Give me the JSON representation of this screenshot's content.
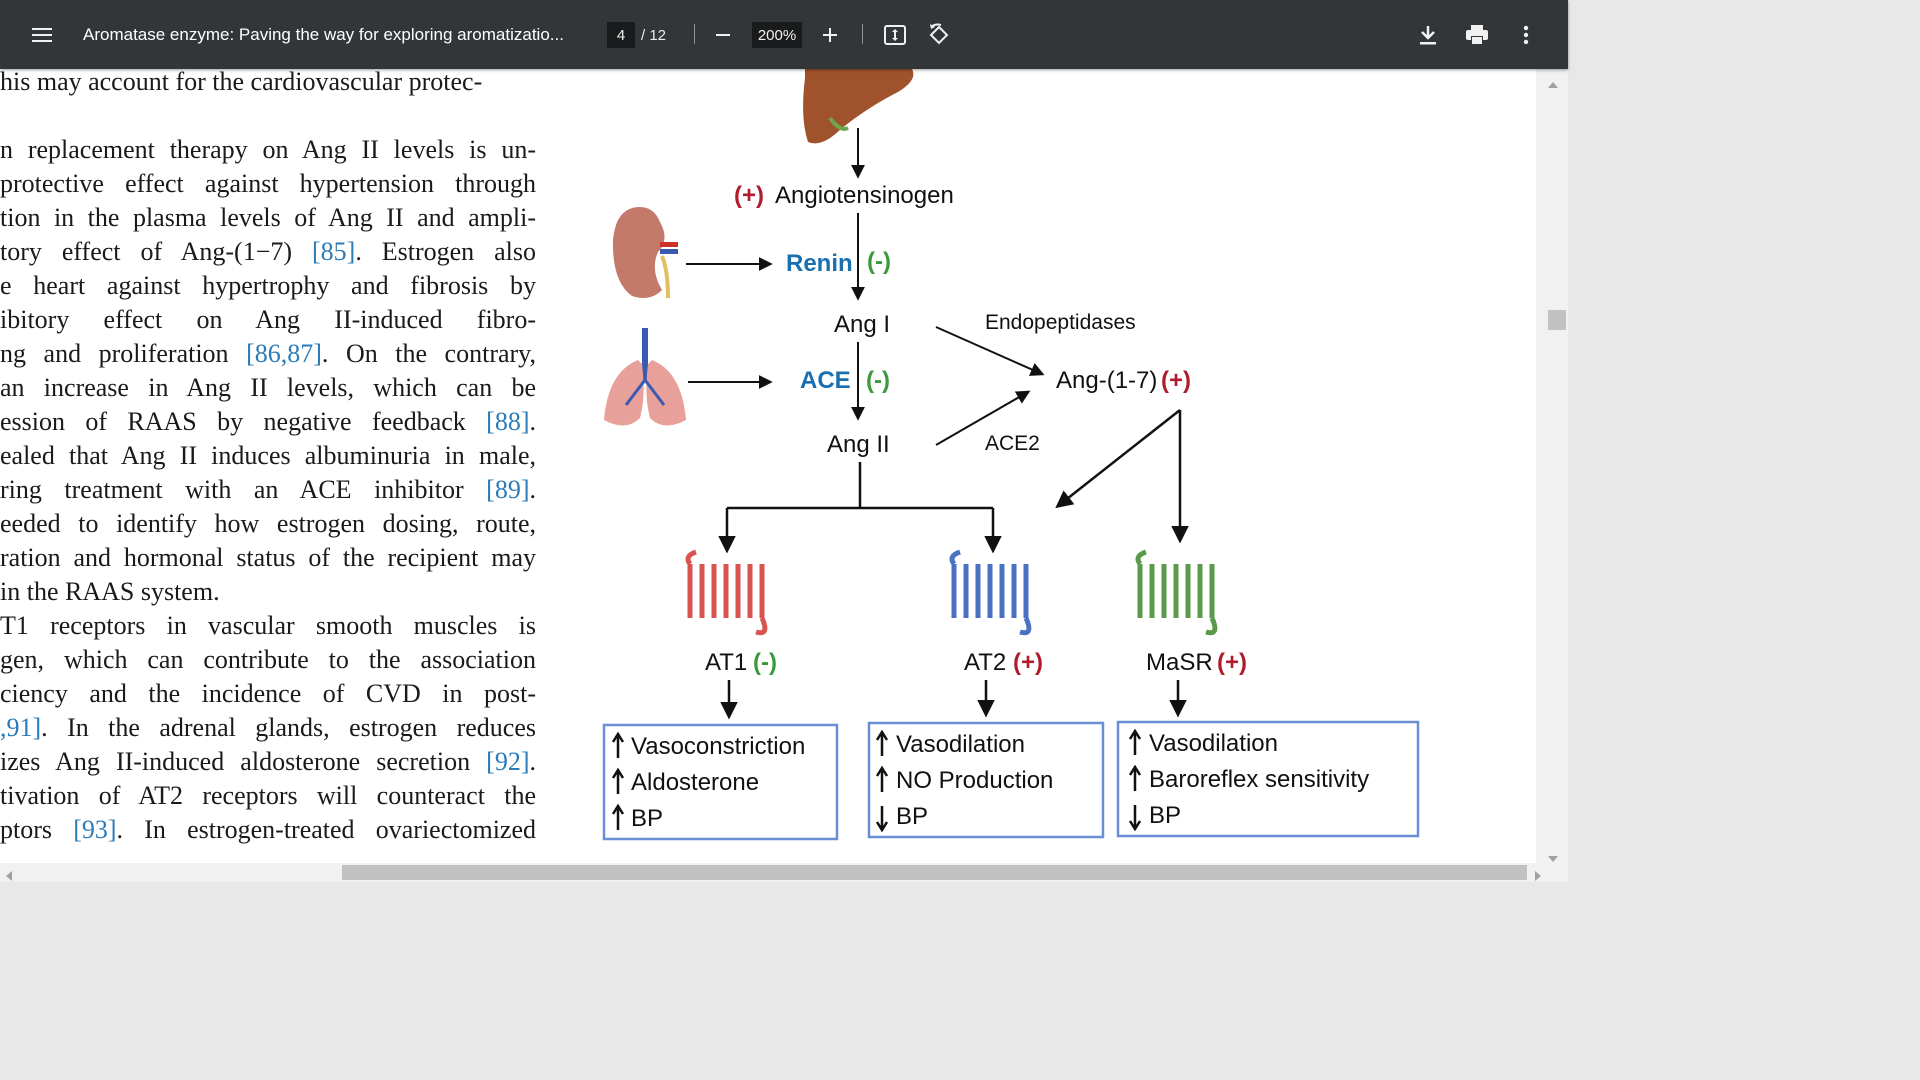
{
  "toolbar": {
    "menu_icon": "hamburger-menu-icon",
    "title": "Aromatase enzyme: Paving the way for exploring aromatizatio...",
    "page_current": "4",
    "page_total": "/ 12",
    "zoom": "200%",
    "icons": [
      "zoom-out-icon",
      "zoom-in-icon",
      "fit-page-icon",
      "rotate-icon",
      "download-icon",
      "print-icon",
      "more-options-icon"
    ]
  },
  "document": {
    "lines": [
      {
        "pre": "his may account for the cardiovascular protec-",
        "ref": "",
        "post": "",
        "last": true
      },
      {
        "pre": "",
        "ref": "",
        "post": "",
        "last": true
      },
      {
        "pre": "n replacement therapy on Ang II levels is un-",
        "ref": "",
        "post": ""
      },
      {
        "pre": "protective effect against hypertension through",
        "ref": "",
        "post": ""
      },
      {
        "pre": "tion in the plasma levels of Ang II and ampli-",
        "ref": "",
        "post": ""
      },
      {
        "pre": "tory effect of Ang-(1−7) ",
        "ref": "[85]",
        "post": ". Estrogen also"
      },
      {
        "pre": "e heart against hypertrophy and fibrosis by",
        "ref": "",
        "post": ""
      },
      {
        "pre": "ibitory effect on Ang II-induced fibro-",
        "ref": "",
        "post": ""
      },
      {
        "pre": "ng and proliferation ",
        "ref": "[86,87]",
        "post": ". On the contrary,"
      },
      {
        "pre": "an increase in Ang II levels, which can be",
        "ref": "",
        "post": ""
      },
      {
        "pre": "ession of RAAS by negative feedback ",
        "ref": "[88]",
        "post": "."
      },
      {
        "pre": "ealed that Ang II induces albuminuria in male,",
        "ref": "",
        "post": ""
      },
      {
        "pre": "ring treatment with an ACE inhibitor ",
        "ref": "[89]",
        "post": "."
      },
      {
        "pre": "eeded to identify how estrogen dosing, route,",
        "ref": "",
        "post": ""
      },
      {
        "pre": "ration and hormonal status of the recipient may",
        "ref": "",
        "post": ""
      },
      {
        "pre": "in the RAAS system.",
        "ref": "",
        "post": "",
        "last": true
      },
      {
        "pre": "T1 receptors in vascular smooth muscles is",
        "ref": "",
        "post": ""
      },
      {
        "pre": "gen, which can contribute to the association",
        "ref": "",
        "post": ""
      },
      {
        "pre": "ciency and the incidence of CVD in post-",
        "ref": "",
        "post": ""
      },
      {
        "pre": "",
        "ref": ",91]",
        "post": ". In the adrenal glands, estrogen reduces"
      },
      {
        "pre": "izes Ang II-induced aldosterone secretion ",
        "ref": "[92]",
        "post": "."
      },
      {
        "pre": "tivation of AT2 receptors will counteract the",
        "ref": "",
        "post": ""
      },
      {
        "pre": "ptors ",
        "ref": "[93]",
        "post": ". In estrogen-treated ovariectomized"
      }
    ]
  },
  "figure": {
    "angiotensinogen": {
      "sign": "(+)",
      "label": "Angiotensinogen"
    },
    "renin": {
      "label": "Renin",
      "sign": "(-)"
    },
    "ang1": "Ang I",
    "ace": {
      "label": "ACE",
      "sign": "(-)"
    },
    "ang2": "Ang II",
    "endopeptidases": "Endopeptidases",
    "ace2": "ACE2",
    "ang17": {
      "label": "Ang-(1-7)",
      "sign": "(+)"
    },
    "at1": {
      "label": "AT1",
      "sign": "(-)"
    },
    "at2": {
      "label": "AT2",
      "sign": "(+)"
    },
    "masr": {
      "label": "MaSR",
      "sign": "(+)"
    },
    "box1": [
      "Vasoconstriction",
      "Aldosterone",
      "BP"
    ],
    "box2": [
      "Vasodilation",
      "NO Production",
      "BP"
    ],
    "box3": [
      "Vasodilation",
      "Baroreflex sensitivity",
      "BP"
    ],
    "organ_icons": [
      "liver-icon",
      "kidney-icon",
      "lungs-icon"
    ],
    "colors": {
      "positive": "#b01c2e",
      "negative": "#3a9a3a",
      "blue": "#1a6fb0",
      "at1": "#d9534f",
      "at2": "#4a72c2",
      "masr": "#5a9a4a",
      "box_border": "#6b8fd6"
    }
  }
}
